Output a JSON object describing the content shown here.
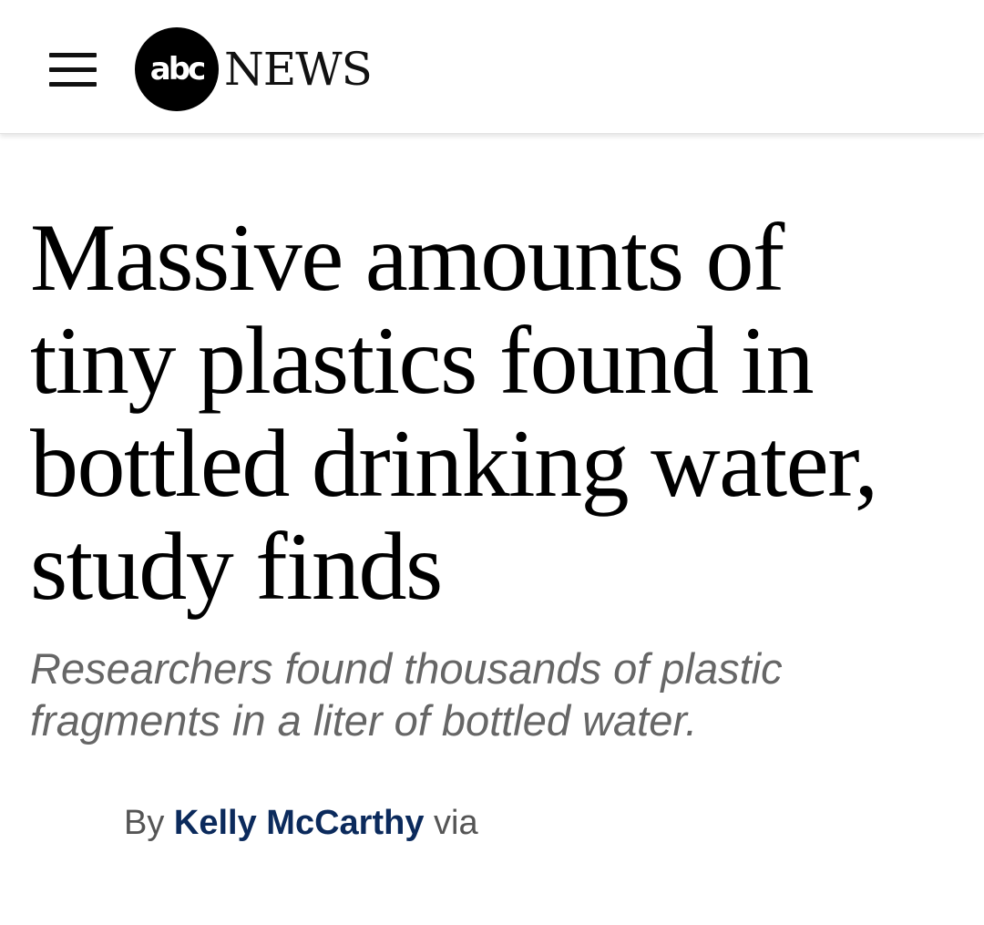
{
  "header": {
    "menu_icon": "hamburger-menu-icon",
    "logo": {
      "circle_text": "abc",
      "word": "NEWS"
    }
  },
  "article": {
    "headline": "Massive amounts of tiny plastics found in bottled drinking water, study finds",
    "subheadline": "Researchers found thousands of plastic fragments in a liter of bottled water.",
    "byline": {
      "prefix": "By",
      "author": "Kelly McCarthy",
      "suffix": "via"
    }
  },
  "colors": {
    "author_link": "#0b2a5c",
    "subheadline": "#666666",
    "logo_background": "#000000"
  }
}
